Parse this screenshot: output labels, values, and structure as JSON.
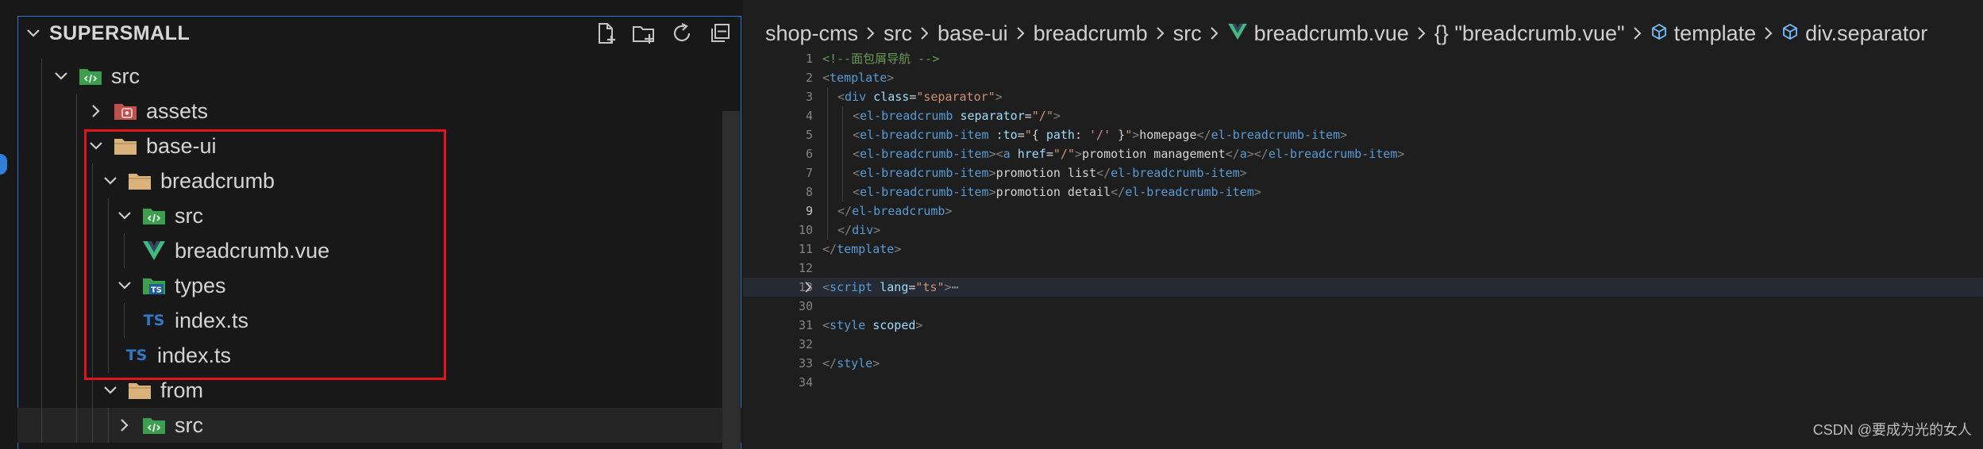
{
  "explorer": {
    "section_title": "SUPERSMALL",
    "actions": [
      {
        "icon": "new-file-icon"
      },
      {
        "icon": "new-folder-icon"
      },
      {
        "icon": "refresh-icon"
      },
      {
        "icon": "collapse-all-icon"
      }
    ],
    "tree": [
      {
        "label": "src",
        "icon": "folder-src-icon",
        "expanded": true,
        "depth": 1
      },
      {
        "label": "assets",
        "icon": "folder-assets-icon",
        "expanded": false,
        "depth": 2
      },
      {
        "label": "base-ui",
        "icon": "folder-icon",
        "expanded": true,
        "depth": 2
      },
      {
        "label": "breadcrumb",
        "icon": "folder-icon",
        "expanded": true,
        "depth": 3
      },
      {
        "label": "src",
        "icon": "folder-src-icon",
        "expanded": true,
        "depth": 4
      },
      {
        "label": "breadcrumb.vue",
        "icon": "vue-icon",
        "expanded": null,
        "depth": 5
      },
      {
        "label": "types",
        "icon": "folder-types-icon",
        "expanded": true,
        "depth": 4
      },
      {
        "label": "index.ts",
        "icon": "ts-icon",
        "expanded": null,
        "depth": 5
      },
      {
        "label": "index.ts",
        "icon": "ts-icon",
        "expanded": null,
        "depth": 4
      },
      {
        "label": "from",
        "icon": "folder-icon",
        "expanded": true,
        "depth": 3
      },
      {
        "label": "src",
        "icon": "folder-src-icon",
        "expanded": false,
        "depth": 4
      }
    ],
    "ts_badge": "TS"
  },
  "editor": {
    "breadcrumb": {
      "project": "shop-cms",
      "p1": "src",
      "p2": "base-ui",
      "p3": "breadcrumb",
      "p4": "src",
      "file": "breadcrumb.vue",
      "symbol": "{} \"breadcrumb.vue\"",
      "node1": "template",
      "node2": "div.separator"
    },
    "lines": [
      {
        "n": "1",
        "indent": 0,
        "tokens": [
          [
            "cm",
            "<!--面包屑导航 -->"
          ]
        ]
      },
      {
        "n": "2",
        "indent": 0,
        "tokens": [
          [
            "br",
            "<"
          ],
          [
            "tag",
            "template"
          ],
          [
            "br",
            ">"
          ]
        ]
      },
      {
        "n": "3",
        "indent": 1,
        "tokens": [
          [
            "br",
            "<"
          ],
          [
            "tag",
            "div"
          ],
          [
            "txt",
            " "
          ],
          [
            "attr",
            "class"
          ],
          [
            "txt",
            "="
          ],
          [
            "str",
            "\"separator\""
          ],
          [
            "br",
            ">"
          ]
        ]
      },
      {
        "n": "4",
        "indent": 2,
        "tokens": [
          [
            "br",
            "<"
          ],
          [
            "tag",
            "el-breadcrumb"
          ],
          [
            "txt",
            " "
          ],
          [
            "attr",
            "separator"
          ],
          [
            "txt",
            "="
          ],
          [
            "str",
            "\"/\""
          ],
          [
            "br",
            ">"
          ]
        ]
      },
      {
        "n": "5",
        "indent": 2,
        "tokens": [
          [
            "br",
            "<"
          ],
          [
            "tag",
            "el-breadcrumb-item"
          ],
          [
            "txt",
            " "
          ],
          [
            "attr",
            ":to"
          ],
          [
            "txt",
            "="
          ],
          [
            "str",
            "\""
          ],
          [
            "txt",
            "{ "
          ],
          [
            "attr",
            "path"
          ],
          [
            "txt",
            ": "
          ],
          [
            "str",
            "'/'"
          ],
          [
            "txt",
            " }"
          ],
          [
            "str",
            "\""
          ],
          [
            "br",
            ">"
          ],
          [
            "txt",
            "homepage"
          ],
          [
            "br",
            "</"
          ],
          [
            "tag",
            "el-breadcrumb-item"
          ],
          [
            "br",
            ">"
          ]
        ]
      },
      {
        "n": "6",
        "indent": 2,
        "tokens": [
          [
            "br",
            "<"
          ],
          [
            "tag",
            "el-breadcrumb-item"
          ],
          [
            "br",
            "><"
          ],
          [
            "tag",
            "a"
          ],
          [
            "txt",
            " "
          ],
          [
            "attr",
            "href"
          ],
          [
            "txt",
            "="
          ],
          [
            "str",
            "\"/\""
          ],
          [
            "br",
            ">"
          ],
          [
            "txt",
            "promotion management"
          ],
          [
            "br",
            "</"
          ],
          [
            "tag",
            "a"
          ],
          [
            "br",
            "></"
          ],
          [
            "tag",
            "el-breadcrumb-item"
          ],
          [
            "br",
            ">"
          ]
        ]
      },
      {
        "n": "7",
        "indent": 2,
        "tokens": [
          [
            "br",
            "<"
          ],
          [
            "tag",
            "el-breadcrumb-item"
          ],
          [
            "br",
            ">"
          ],
          [
            "txt",
            "promotion list"
          ],
          [
            "br",
            "</"
          ],
          [
            "tag",
            "el-breadcrumb-item"
          ],
          [
            "br",
            ">"
          ]
        ]
      },
      {
        "n": "8",
        "indent": 2,
        "tokens": [
          [
            "br",
            "<"
          ],
          [
            "tag",
            "el-breadcrumb-item"
          ],
          [
            "br",
            ">"
          ],
          [
            "txt",
            "promotion detail"
          ],
          [
            "br",
            "</"
          ],
          [
            "tag",
            "el-breadcrumb-item"
          ],
          [
            "br",
            ">"
          ]
        ]
      },
      {
        "n": "9",
        "indent": 1,
        "tokens": [
          [
            "br",
            "</"
          ],
          [
            "tag",
            "el-breadcrumb"
          ],
          [
            "br",
            ">"
          ]
        ]
      },
      {
        "n": "10",
        "indent": 1,
        "tokens": [
          [
            "br",
            "</"
          ],
          [
            "tag",
            "div"
          ],
          [
            "br",
            ">"
          ]
        ]
      },
      {
        "n": "11",
        "indent": 0,
        "tokens": [
          [
            "br",
            "</"
          ],
          [
            "tag",
            "template"
          ],
          [
            "br",
            ">"
          ]
        ]
      },
      {
        "n": "12",
        "indent": 0,
        "tokens": []
      },
      {
        "n": "13",
        "indent": 0,
        "tokens": [
          [
            "br",
            "<"
          ],
          [
            "tag",
            "script"
          ],
          [
            "txt",
            " "
          ],
          [
            "attr",
            "lang"
          ],
          [
            "txt",
            "="
          ],
          [
            "str",
            "\"ts\""
          ],
          [
            "br",
            ">"
          ],
          [
            "fold",
            "⋯"
          ]
        ]
      },
      {
        "n": "30",
        "indent": 0,
        "tokens": []
      },
      {
        "n": "31",
        "indent": 0,
        "tokens": [
          [
            "br",
            "<"
          ],
          [
            "tag",
            "style"
          ],
          [
            "txt",
            " "
          ],
          [
            "attr",
            "scoped"
          ],
          [
            "br",
            ">"
          ]
        ]
      },
      {
        "n": "32",
        "indent": 0,
        "tokens": []
      },
      {
        "n": "33",
        "indent": 0,
        "tokens": [
          [
            "br",
            "</"
          ],
          [
            "tag",
            "style"
          ],
          [
            "br",
            ">"
          ]
        ]
      },
      {
        "n": "34",
        "indent": 0,
        "tokens": []
      }
    ],
    "active_line": "9",
    "folded_line": "13"
  },
  "watermark": "CSDN @要成为光的女人",
  "colors": {
    "accent": "#2b79d6",
    "selection_box": "#e0141a",
    "vue_green": "#41b883",
    "ts_blue": "#3178c6",
    "folder_tan": "#d9b27c"
  }
}
